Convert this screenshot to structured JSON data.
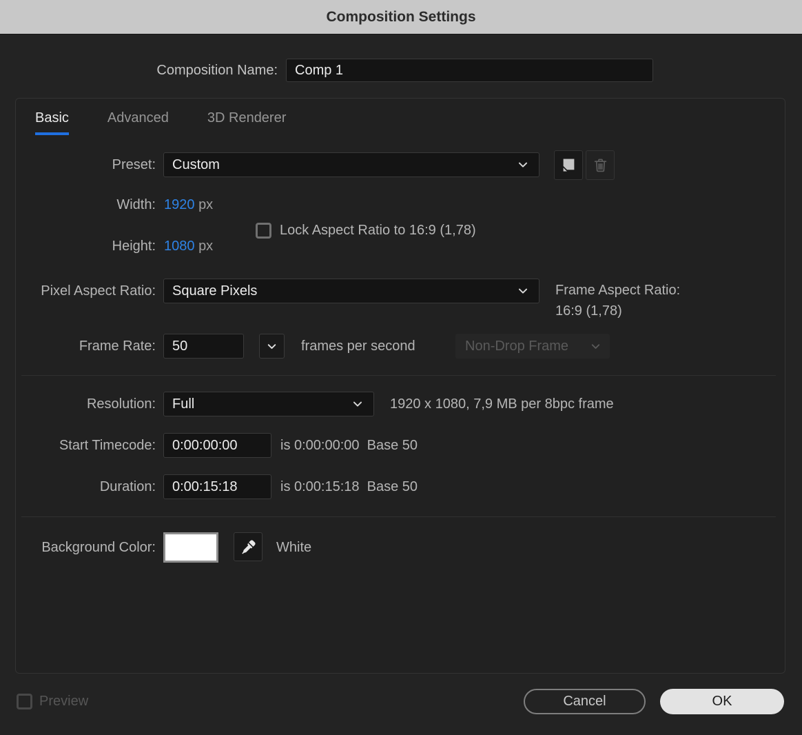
{
  "title_bar": {
    "title": "Composition Settings"
  },
  "colors": {
    "accent_blue": "#2e83e6",
    "tab_underline": "#1f6fe0",
    "titlebar_bg": "#c8c8c8",
    "dialog_bg": "#232323",
    "swatch_color": "#ffffff"
  },
  "composition_name": {
    "label": "Composition Name:",
    "value": "Comp 1"
  },
  "tabs": {
    "basic": "Basic",
    "advanced": "Advanced",
    "renderer": "3D Renderer",
    "active": "Basic"
  },
  "preset": {
    "label": "Preset:",
    "value": "Custom",
    "save_icon": "save-preset-icon",
    "delete_icon": "trash-icon"
  },
  "dimensions": {
    "width_label": "Width:",
    "width_value": "1920",
    "width_unit": "px",
    "height_label": "Height:",
    "height_value": "1080",
    "height_unit": "px",
    "lock_aspect_label": "Lock Aspect Ratio to 16:9 (1,78)",
    "lock_aspect_checked": false
  },
  "pixel_aspect_ratio": {
    "label": "Pixel Aspect Ratio:",
    "value": "Square Pixels"
  },
  "frame_aspect_ratio": {
    "label": "Frame Aspect Ratio:",
    "value": "16:9 (1,78)"
  },
  "frame_rate": {
    "label": "Frame Rate:",
    "value": "50",
    "unit": "frames per second",
    "drop_frame_value": "Non-Drop Frame",
    "drop_frame_enabled": false
  },
  "resolution": {
    "label": "Resolution:",
    "value": "Full",
    "info": "1920 x 1080, 7,9 MB per 8bpc frame"
  },
  "start_timecode": {
    "label": "Start Timecode:",
    "value": "0:00:00:00",
    "info": "is 0:00:00:00  Base 50"
  },
  "duration": {
    "label": "Duration:",
    "value": "0:00:15:18",
    "info": "is 0:00:15:18  Base 50"
  },
  "background_color": {
    "label": "Background Color:",
    "value_name": "White",
    "swatch_color": "#ffffff",
    "eyedropper_icon": "eyedropper-icon"
  },
  "footer": {
    "preview_label": "Preview",
    "preview_checked": false,
    "cancel_label": "Cancel",
    "ok_label": "OK"
  }
}
